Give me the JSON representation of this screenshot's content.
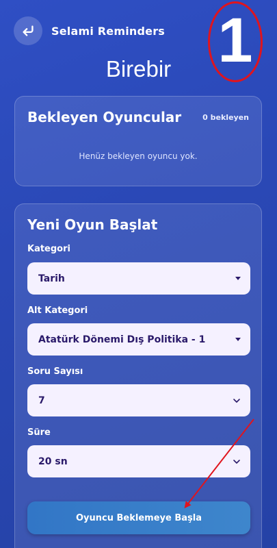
{
  "header": {
    "app_title": "Selami Reminders"
  },
  "annotation": {
    "number": "1",
    "color": "#e0141e"
  },
  "page_title": "Birebir",
  "waiting": {
    "title": "Bekleyen Oyuncular",
    "count": "0 bekleyen",
    "empty_text": "Henüz bekleyen oyuncu yok."
  },
  "new_game": {
    "title": "Yeni Oyun Başlat",
    "category_label": "Kategori",
    "category_value": "Tarih",
    "subcategory_label": "Alt Kategori",
    "subcategory_value": "Atatürk Dönemi Dış Politika - 1",
    "question_count_label": "Soru Sayısı",
    "question_count_value": "7",
    "duration_label": "Süre",
    "duration_value": "20 sn",
    "start_button": "Oyuncu Beklemeye Başla"
  },
  "colors": {
    "background": "#2a48b6",
    "select_bg": "#f5f1ff",
    "select_text": "#2a1a6a",
    "button": "#3a80c9"
  }
}
